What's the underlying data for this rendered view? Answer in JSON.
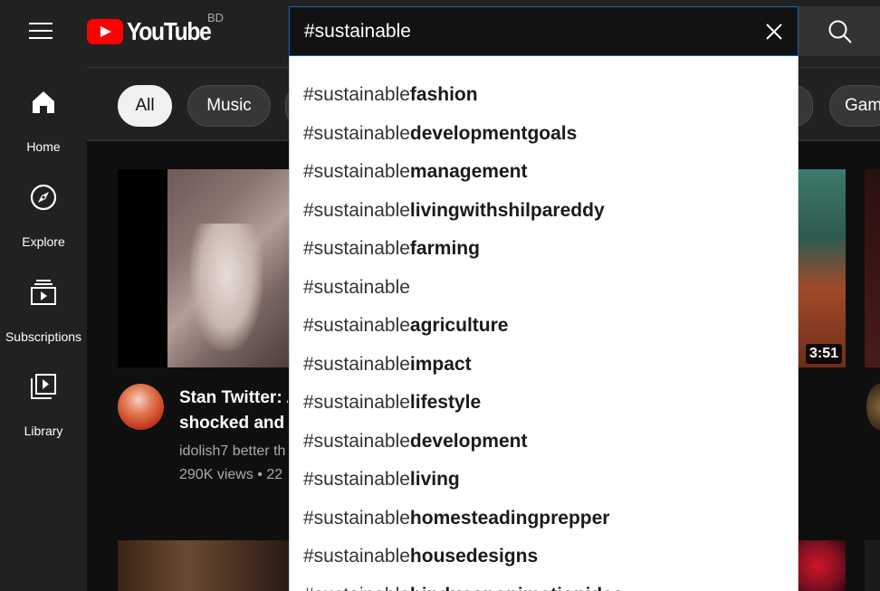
{
  "header": {
    "logo_text": "YouTube",
    "country_code": "BD",
    "search_value": "#sustainable",
    "icons": {
      "menu": "hamburger-menu-icon",
      "clear": "close-icon",
      "search": "search-icon"
    }
  },
  "sidebar": {
    "items": [
      {
        "label": "Home",
        "icon": "home-icon"
      },
      {
        "label": "Explore",
        "icon": "compass-icon"
      },
      {
        "label": "Subscriptions",
        "icon": "subscriptions-icon"
      },
      {
        "label": "Library",
        "icon": "library-icon"
      }
    ]
  },
  "chips": {
    "all": "All",
    "music": "Music",
    "gaming_partial": "Gam"
  },
  "videos": [
    {
      "title_line1": "Stan Twitter: A",
      "title_line2": "shocked and f",
      "channel": "idolish7 better th",
      "meta": "290K views • 22"
    }
  ],
  "thumbnail_durations": {
    "right_video": "3:51"
  },
  "suggestions": {
    "query": "#sustainable",
    "items": [
      "fashion",
      "developmentgoals",
      "management",
      "livingwithshilpareddy",
      "farming",
      "",
      "agriculture",
      "impact",
      "lifestyle",
      "development",
      "living",
      "homesteadingprepper",
      "housedesigns",
      "hindusanonimationidea"
    ]
  },
  "colors": {
    "brand_red": "#ff0000",
    "focus_border": "#1c62b9",
    "background": "#0f0f0f",
    "surface": "#212121"
  }
}
